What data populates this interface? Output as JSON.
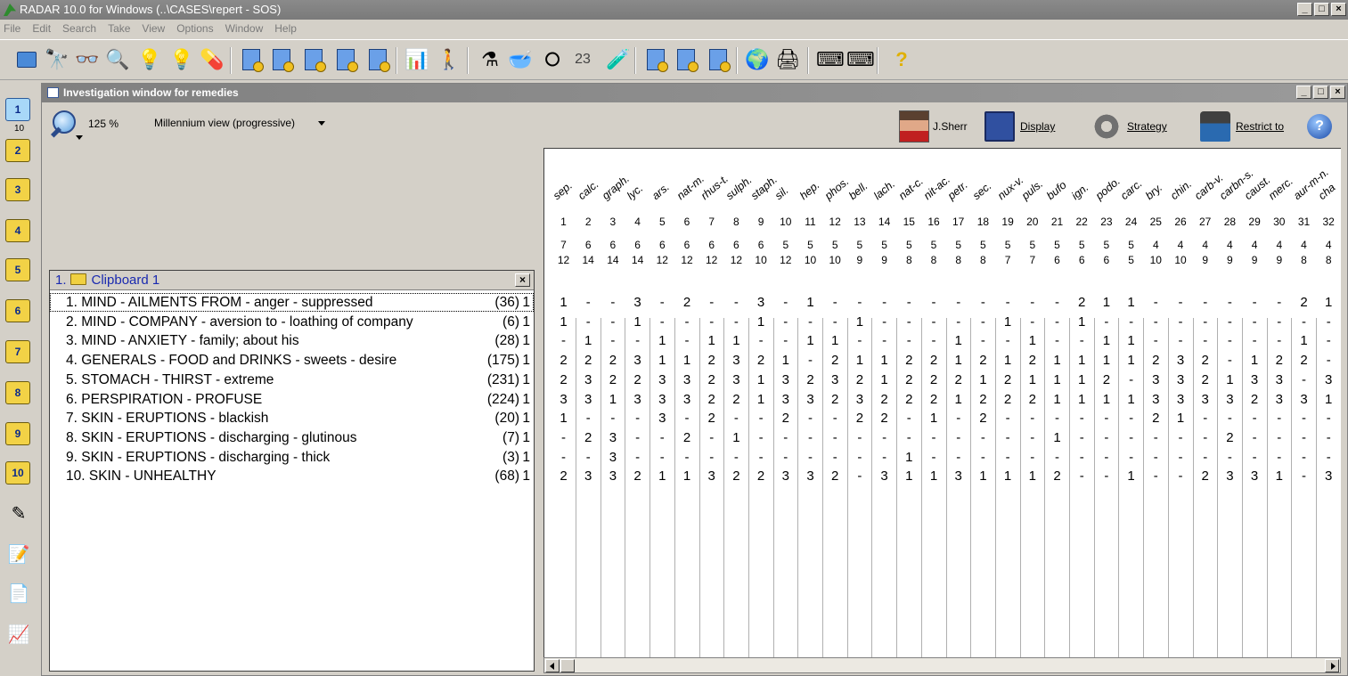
{
  "window": {
    "title": "RADAR 10.0 for Windows  (..\\CASES\\repert - SOS)"
  },
  "menu": [
    "File",
    "Edit",
    "Search",
    "Take",
    "View",
    "Options",
    "Window",
    "Help"
  ],
  "winbtns": [
    "_",
    "□",
    "×"
  ],
  "toolbar_icons": [
    "open-folder-icon",
    "binoculars-icon",
    "glasses-icon",
    "magnifier-icon",
    "lightbulb-icon",
    "lightbulb-search-icon",
    "pills-icon",
    "clipboard-1-icon",
    "clipboard-2-icon",
    "clipboard-3-icon",
    "clipboard-4-icon",
    "clipboard-5-icon",
    "bar-chart-icon",
    "person-analysis-icon",
    "flask-icon",
    "bowl-icon",
    "lifebuoy-icon",
    "number-23-icon",
    "bottle-icon",
    "doc-transfer-icon",
    "doc-view-icon",
    "doc-frame-icon",
    "globe-icon",
    "printer-icon",
    "keyboard-left-icon",
    "keyboard-right-icon",
    "help-question-icon"
  ],
  "left_toolbar": {
    "items": [
      "1",
      "2",
      "3",
      "4",
      "5",
      "6",
      "7",
      "8",
      "9",
      "10"
    ],
    "sub_label": "10",
    "extra_icons": [
      "pen-icon",
      "notepad-icon",
      "copy-docs-icon",
      "graph-icon"
    ]
  },
  "investigation": {
    "title": "Investigation window for remedies",
    "zoom": "125 %",
    "view_mode": "Millennium view (progressive)",
    "user": "J.Sherr",
    "display_label": "Display",
    "strategy_label": "Strategy",
    "restrict_label": "Restrict to"
  },
  "clipboard": {
    "number": "1.",
    "title": "Clipboard 1",
    "close": "×",
    "rubrics": [
      {
        "label": "1. MIND - AILMENTS FROM - anger - suppressed",
        "count": "(36)",
        "weight": "1"
      },
      {
        "label": "2. MIND - COMPANY - aversion to - loathing of company",
        "count": "(6)",
        "weight": "1"
      },
      {
        "label": "3. MIND - ANXIETY - family; about his",
        "count": "(28)",
        "weight": "1"
      },
      {
        "label": "4. GENERALS - FOOD and DRINKS - sweets - desire",
        "count": "(175)",
        "weight": "1"
      },
      {
        "label": "5. STOMACH - THIRST - extreme",
        "count": "(231)",
        "weight": "1"
      },
      {
        "label": "6. PERSPIRATION - PROFUSE",
        "count": "(224)",
        "weight": "1"
      },
      {
        "label": "7. SKIN - ERUPTIONS - blackish",
        "count": "(20)",
        "weight": "1"
      },
      {
        "label": "8. SKIN - ERUPTIONS - discharging - glutinous",
        "count": "(7)",
        "weight": "1"
      },
      {
        "label": "9. SKIN - ERUPTIONS - discharging - thick",
        "count": "(3)",
        "weight": "1"
      },
      {
        "label": "10. SKIN - UNHEALTHY",
        "count": "(68)",
        "weight": "1"
      }
    ]
  },
  "remedies": [
    {
      "name": "sep.",
      "rank": "1",
      "hits": "7",
      "score": "12"
    },
    {
      "name": "calc.",
      "rank": "2",
      "hits": "6",
      "score": "14"
    },
    {
      "name": "graph.",
      "rank": "3",
      "hits": "6",
      "score": "14"
    },
    {
      "name": "lyc.",
      "rank": "4",
      "hits": "6",
      "score": "14"
    },
    {
      "name": "ars.",
      "rank": "5",
      "hits": "6",
      "score": "12"
    },
    {
      "name": "nat-m.",
      "rank": "6",
      "hits": "6",
      "score": "12"
    },
    {
      "name": "rhus-t.",
      "rank": "7",
      "hits": "6",
      "score": "12"
    },
    {
      "name": "sulph.",
      "rank": "8",
      "hits": "6",
      "score": "12"
    },
    {
      "name": "staph.",
      "rank": "9",
      "hits": "6",
      "score": "10"
    },
    {
      "name": "sil.",
      "rank": "10",
      "hits": "5",
      "score": "12"
    },
    {
      "name": "hep.",
      "rank": "11",
      "hits": "5",
      "score": "10"
    },
    {
      "name": "phos.",
      "rank": "12",
      "hits": "5",
      "score": "10"
    },
    {
      "name": "bell.",
      "rank": "13",
      "hits": "5",
      "score": "9"
    },
    {
      "name": "lach.",
      "rank": "14",
      "hits": "5",
      "score": "9"
    },
    {
      "name": "nat-c.",
      "rank": "15",
      "hits": "5",
      "score": "8"
    },
    {
      "name": "nit-ac.",
      "rank": "16",
      "hits": "5",
      "score": "8"
    },
    {
      "name": "petr.",
      "rank": "17",
      "hits": "5",
      "score": "8"
    },
    {
      "name": "sec.",
      "rank": "18",
      "hits": "5",
      "score": "8"
    },
    {
      "name": "nux-v.",
      "rank": "19",
      "hits": "5",
      "score": "7"
    },
    {
      "name": "puls.",
      "rank": "20",
      "hits": "5",
      "score": "7"
    },
    {
      "name": "bufo",
      "rank": "21",
      "hits": "5",
      "score": "6"
    },
    {
      "name": "ign.",
      "rank": "22",
      "hits": "5",
      "score": "6"
    },
    {
      "name": "podo.",
      "rank": "23",
      "hits": "5",
      "score": "6"
    },
    {
      "name": "carc.",
      "rank": "24",
      "hits": "5",
      "score": "5"
    },
    {
      "name": "bry.",
      "rank": "25",
      "hits": "4",
      "score": "10"
    },
    {
      "name": "chin.",
      "rank": "26",
      "hits": "4",
      "score": "10"
    },
    {
      "name": "carb-v.",
      "rank": "27",
      "hits": "4",
      "score": "9"
    },
    {
      "name": "carbn-s.",
      "rank": "28",
      "hits": "4",
      "score": "9"
    },
    {
      "name": "caust.",
      "rank": "29",
      "hits": "4",
      "score": "9"
    },
    {
      "name": "merc.",
      "rank": "30",
      "hits": "4",
      "score": "9"
    },
    {
      "name": "aur-m-n.",
      "rank": "31",
      "hits": "4",
      "score": "8"
    },
    {
      "name": "cha",
      "rank": "32",
      "hits": "4",
      "score": "8"
    }
  ],
  "grid_values": [
    [
      "1",
      "-",
      "-",
      "3",
      "-",
      "2",
      "-",
      "-",
      "3",
      "-",
      "1",
      "-",
      "-",
      "-",
      "-",
      "-",
      "-",
      "-",
      "-",
      "-",
      "-",
      "2",
      "1",
      "1",
      "-",
      "-",
      "-",
      "-",
      "-",
      "-",
      "2",
      "1"
    ],
    [
      "1",
      "-",
      "-",
      "1",
      "-",
      "-",
      "-",
      "-",
      "1",
      "-",
      "-",
      "-",
      "1",
      "-",
      "-",
      "-",
      "-",
      "-",
      "1",
      "-",
      "-",
      "1",
      "-",
      "-",
      "-",
      "-",
      "-",
      "-",
      "-",
      "-",
      "-",
      "-"
    ],
    [
      "-",
      "1",
      "-",
      "-",
      "1",
      "-",
      "1",
      "1",
      "-",
      "-",
      "1",
      "1",
      "-",
      "-",
      "-",
      "-",
      "1",
      "-",
      "-",
      "1",
      "-",
      "-",
      "1",
      "1",
      "-",
      "-",
      "-",
      "-",
      "-",
      "-",
      "1",
      "-"
    ],
    [
      "2",
      "2",
      "2",
      "3",
      "1",
      "1",
      "2",
      "3",
      "2",
      "1",
      "-",
      "2",
      "1",
      "1",
      "2",
      "2",
      "1",
      "2",
      "1",
      "2",
      "1",
      "1",
      "1",
      "1",
      "2",
      "3",
      "2",
      "-",
      "1",
      "2",
      "2",
      "-"
    ],
    [
      "2",
      "3",
      "2",
      "2",
      "3",
      "3",
      "2",
      "3",
      "1",
      "3",
      "2",
      "3",
      "2",
      "1",
      "2",
      "2",
      "2",
      "1",
      "2",
      "1",
      "1",
      "1",
      "2",
      "-",
      "3",
      "3",
      "2",
      "1",
      "3",
      "3",
      "-",
      "3"
    ],
    [
      "3",
      "3",
      "1",
      "3",
      "3",
      "3",
      "2",
      "2",
      "1",
      "3",
      "3",
      "2",
      "3",
      "2",
      "2",
      "2",
      "1",
      "2",
      "2",
      "2",
      "1",
      "1",
      "1",
      "1",
      "3",
      "3",
      "3",
      "3",
      "2",
      "3",
      "3",
      "1"
    ],
    [
      "1",
      "-",
      "-",
      "-",
      "3",
      "-",
      "2",
      "-",
      "-",
      "2",
      "-",
      "-",
      "2",
      "2",
      "-",
      "1",
      "-",
      "2",
      "-",
      "-",
      "-",
      "-",
      "-",
      "-",
      "2",
      "1",
      "-",
      "-",
      "-",
      "-",
      "-",
      "-"
    ],
    [
      "-",
      "2",
      "3",
      "-",
      "-",
      "2",
      "-",
      "1",
      "-",
      "-",
      "-",
      "-",
      "-",
      "-",
      "-",
      "-",
      "-",
      "-",
      "-",
      "-",
      "1",
      "-",
      "-",
      "-",
      "-",
      "-",
      "-",
      "2",
      "-",
      "-",
      "-",
      "-"
    ],
    [
      "-",
      "-",
      "3",
      "-",
      "-",
      "-",
      "-",
      "-",
      "-",
      "-",
      "-",
      "-",
      "-",
      "-",
      "1",
      "-",
      "-",
      "-",
      "-",
      "-",
      "-",
      "-",
      "-",
      "-",
      "-",
      "-",
      "-",
      "-",
      "-",
      "-",
      "-",
      "-"
    ],
    [
      "2",
      "3",
      "3",
      "2",
      "1",
      "1",
      "3",
      "2",
      "2",
      "3",
      "3",
      "2",
      "-",
      "3",
      "1",
      "1",
      "3",
      "1",
      "1",
      "1",
      "2",
      "-",
      "-",
      "1",
      "-",
      "-",
      "2",
      "3",
      "3",
      "1",
      "-",
      "3"
    ]
  ]
}
